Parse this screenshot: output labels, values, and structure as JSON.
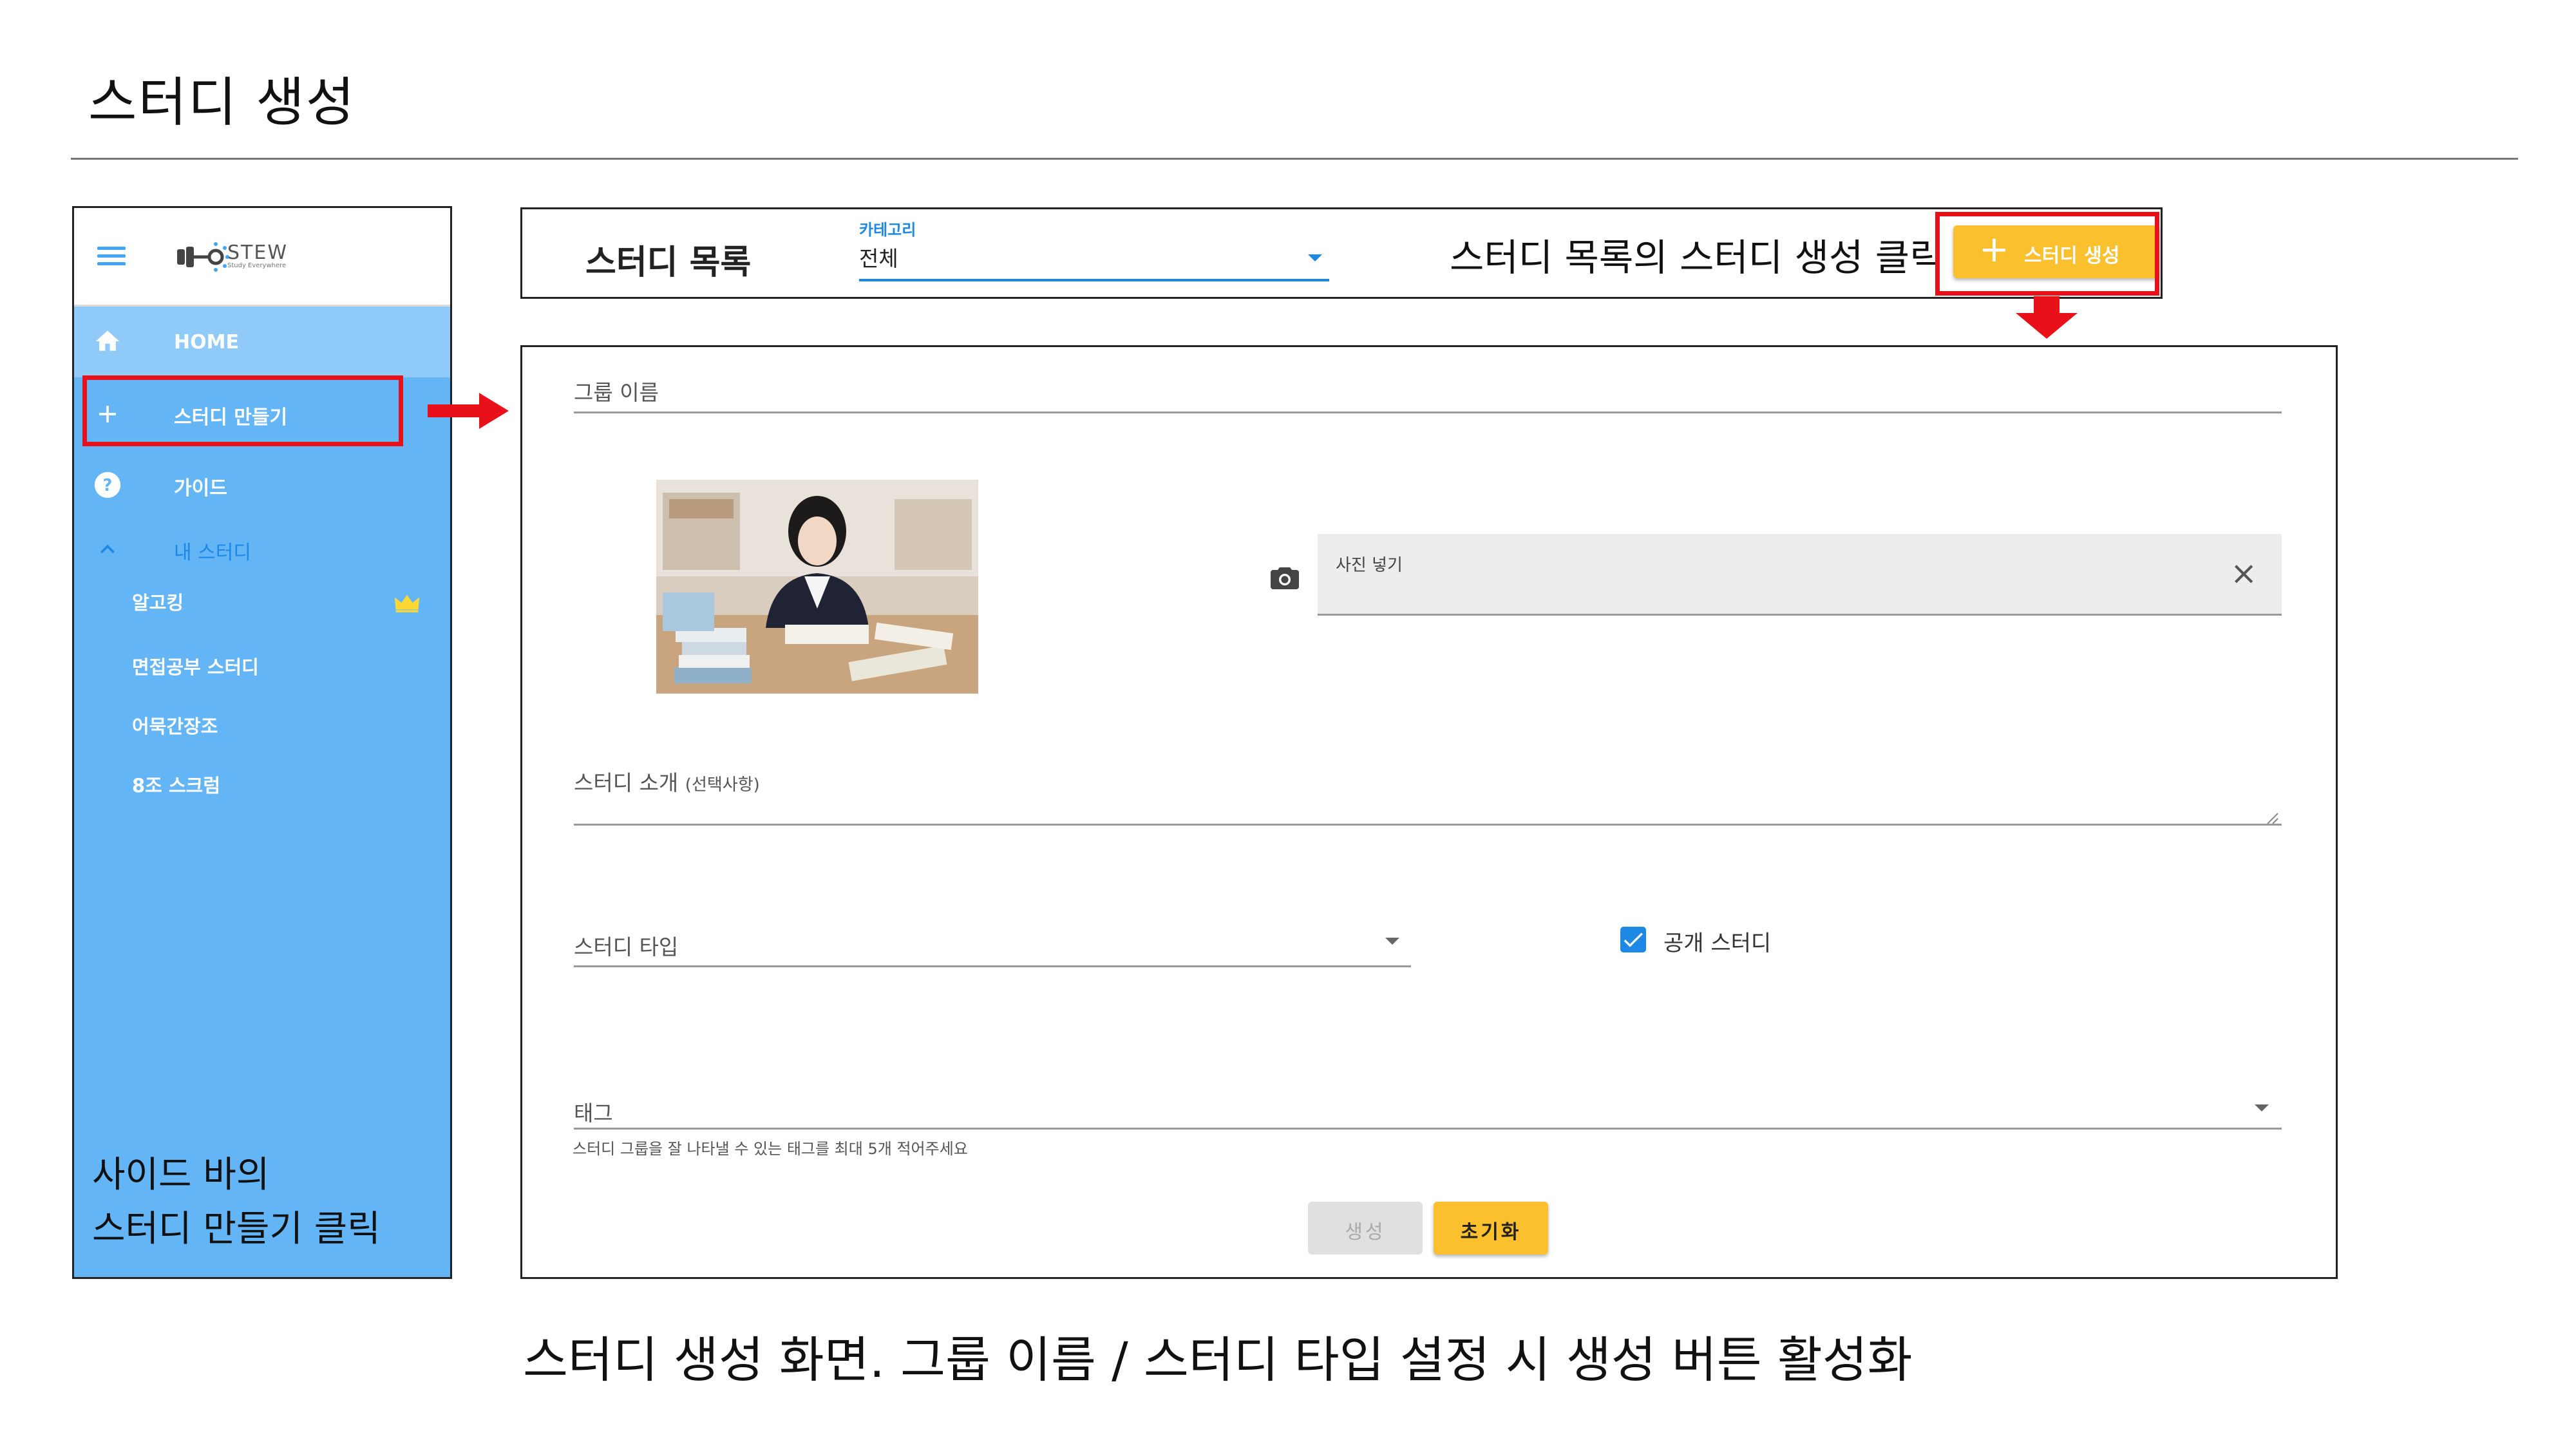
{
  "page": {
    "title": "스터디 생성",
    "bottom_caption": "스터디 생성 화면. 그룹 이름 / 스터디 타입 설정 시 생성 버튼 활성화"
  },
  "sidebar": {
    "logo_text": "STEW",
    "logo_sub": "Study Everywhere",
    "items": [
      {
        "label": "HOME",
        "icon": "home-icon"
      },
      {
        "label": "스터디 만들기",
        "icon": "plus-icon"
      },
      {
        "label": "가이드",
        "icon": "help-icon"
      },
      {
        "label": "내 스터디",
        "icon": "chevron-up-icon"
      }
    ],
    "studies": [
      {
        "label": "알고킹",
        "badge": "crown-icon"
      },
      {
        "label": "면접공부 스터디"
      },
      {
        "label": "어묵간장조"
      },
      {
        "label": "8조 스크럼"
      }
    ],
    "caption_line1": "사이드 바의",
    "caption_line2": "스터디 만들기 클릭"
  },
  "study_list": {
    "title": "스터디 목록",
    "category_label": "카테고리",
    "category_value": "전체",
    "instruction": "스터디 목록의 스터디 생성 클릭",
    "create_button": "스터디 생성"
  },
  "form": {
    "group_name_label": "그룹 이름",
    "photo_label": "사진 넣기",
    "intro_label": "스터디 소개",
    "intro_optional": "(선택사항)",
    "type_label": "스터디 타입",
    "public_label": "공개 스터디",
    "public_checked": true,
    "tag_label": "태그",
    "tag_hint": "스터디 그룹을 잘 나타낼 수 있는 태그를 최대 5개 적어주세요",
    "create_button": "생성",
    "reset_button": "초기화"
  },
  "colors": {
    "sidebar_bg": "#64b5f6",
    "sidebar_home_bg": "#90caf9",
    "accent_yellow": "#fbc02d",
    "accent_blue": "#1e88e5",
    "highlight_red": "#e8111a"
  }
}
